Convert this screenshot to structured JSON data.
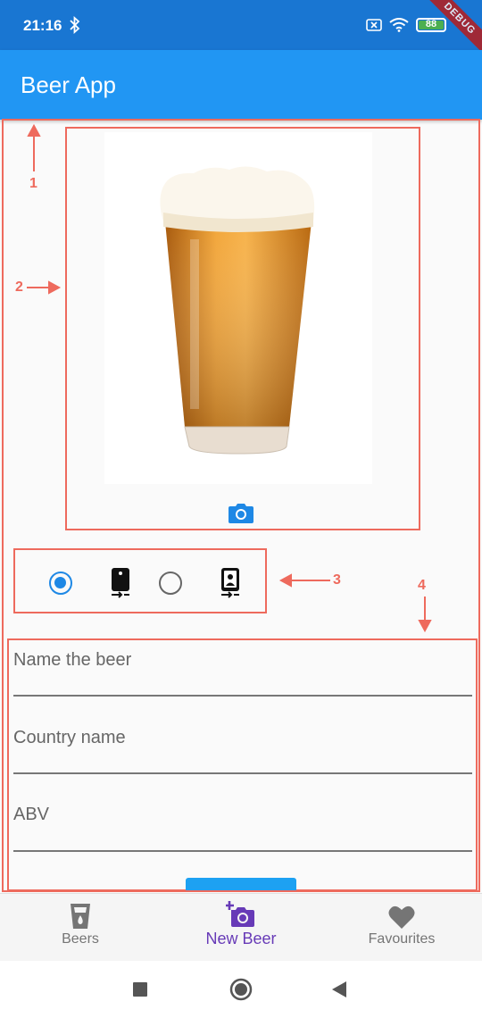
{
  "status_bar": {
    "time": "21:16",
    "battery": "88",
    "debug_banner": "DEBUG"
  },
  "app_bar": {
    "title": "Beer App"
  },
  "annotations": [
    "1",
    "2",
    "3",
    "4"
  ],
  "image_picker": {
    "icon": "camera-icon",
    "accent": "#1e88e5"
  },
  "camera_options": {
    "selected": "rear-camera",
    "options": [
      {
        "icon": "camera-rear-icon",
        "selected": true
      },
      {
        "icon": "camera-front-icon",
        "selected": false
      }
    ]
  },
  "form": {
    "fields": [
      {
        "label": "Name the beer",
        "value": ""
      },
      {
        "label": "Country name",
        "value": ""
      },
      {
        "label": "ABV",
        "value": ""
      }
    ]
  },
  "bottom_nav": {
    "items": [
      {
        "label": "Beers",
        "icon": "beer-glass-icon",
        "active": false
      },
      {
        "label": "New Beer",
        "icon": "add-a-photo-icon",
        "active": true
      },
      {
        "label": "Favourites",
        "icon": "heart-icon",
        "active": false
      }
    ],
    "active_color": "#673ab7"
  },
  "colors": {
    "app_bar": "#2196f3",
    "status_bar": "#1976d2",
    "annotation": "#ee6a5d"
  }
}
